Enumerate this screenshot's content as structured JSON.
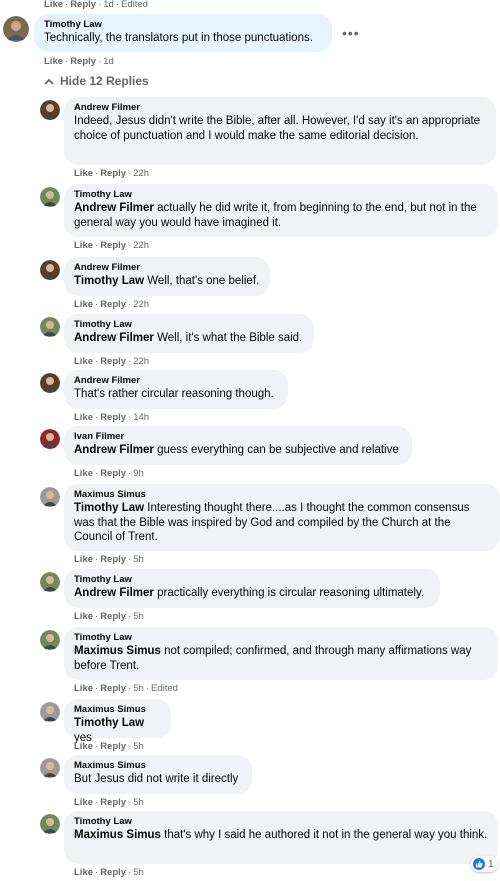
{
  "actions": {
    "like": "Like",
    "reply": "Reply",
    "sep": "·",
    "edited": "Edited"
  },
  "top_meta": {
    "time": "1d"
  },
  "parent": {
    "author": "Timothy Law",
    "text": "Technically, the translators put in those punctuations.",
    "time": "1d"
  },
  "hide_replies_label": "Hide 12 Replies",
  "replies": [
    {
      "author": "Andrew Filmer",
      "tag": "",
      "text": "Indeed, Jesus didn't write the Bible, after all. However, I'd say it's an appropriate choice of punctuation and I would make the same editorial decision.",
      "time": "22h"
    },
    {
      "author": "Timothy Law",
      "tag": "Andrew Filmer",
      "text": "actually he did write it, from beginning to the end, but not in the general way you would have imagined it.",
      "time": "22h"
    },
    {
      "author": "Andrew Filmer",
      "tag": "Timothy Law",
      "text": "Well, that's one belief.",
      "time": "22h"
    },
    {
      "author": "Timothy Law",
      "tag": "Andrew Filmer",
      "text": "Well, it's what the Bible said.",
      "time": "22h"
    },
    {
      "author": "Andrew Filmer",
      "tag": "",
      "text": "That's rather circular reasoning though.",
      "time": "14h"
    },
    {
      "author": "Ivan Filmer",
      "tag": "Andrew Filmer",
      "text": "guess everything can be subjective and relative",
      "time": "9h"
    },
    {
      "author": "Maximus Simus",
      "tag": "Timothy Law",
      "text": "Interesting thought there....as I thought the common consensus was that the Bible was inspired by God and compiled by the Church at the Council of Trent.",
      "time": "5h"
    },
    {
      "author": "Timothy Law",
      "tag": "Andrew Filmer",
      "text": "practically everything is circular reasoning ultimately.",
      "time": "5h"
    },
    {
      "author": "Timothy Law",
      "tag": "Maximus Simus",
      "text": "not compiled; confirmed, and through many affirmations way before Trent.",
      "time": "5h",
      "edited": true
    },
    {
      "author": "Maximus Simus",
      "tag": "Timothy Law",
      "text": "yes",
      "time": "5h"
    },
    {
      "author": "Maximus Simus",
      "tag": "",
      "text": "But Jesus did not write it directly",
      "time": "5h"
    },
    {
      "author": "Timothy Law",
      "tag": "Maximus Simus",
      "text": "that's why I said he authored it not in the general way you think.",
      "time": "5h"
    }
  ],
  "last_reaction": {
    "icon": "like-icon",
    "count": "1"
  },
  "colors": {
    "link_blue": "#1877f2",
    "bubble": "#f0f2f5",
    "meta": "#65676b"
  }
}
